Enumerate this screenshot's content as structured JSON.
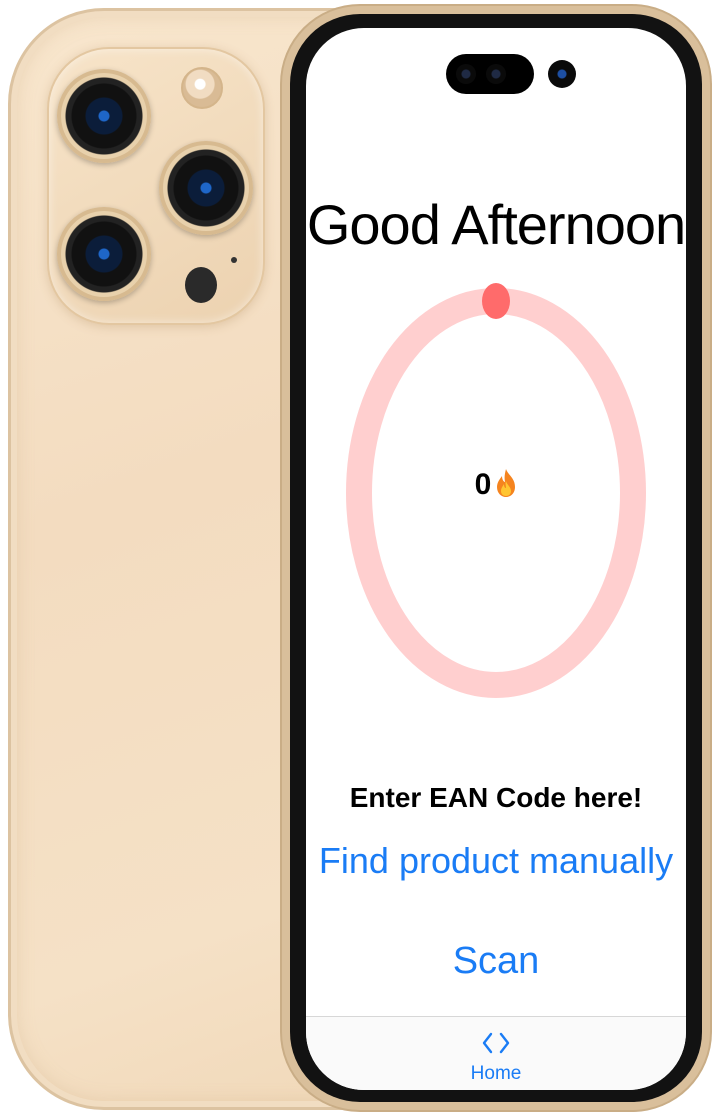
{
  "main": {
    "greeting": "Good Afternoon",
    "streak_count": "0",
    "progress_fraction": 0,
    "ring_track_color": "#ffcfcf",
    "ring_indicator_color": "#ff6b6b",
    "ean_label": "Enter EAN Code here!",
    "find_product_button": "Find product manually",
    "scan_button": "Scan",
    "accent_color": "#1a7cf5"
  },
  "tabbar": {
    "items": [
      {
        "label": "Home",
        "icon": "code-chevrons-icon",
        "selected": true
      }
    ]
  }
}
